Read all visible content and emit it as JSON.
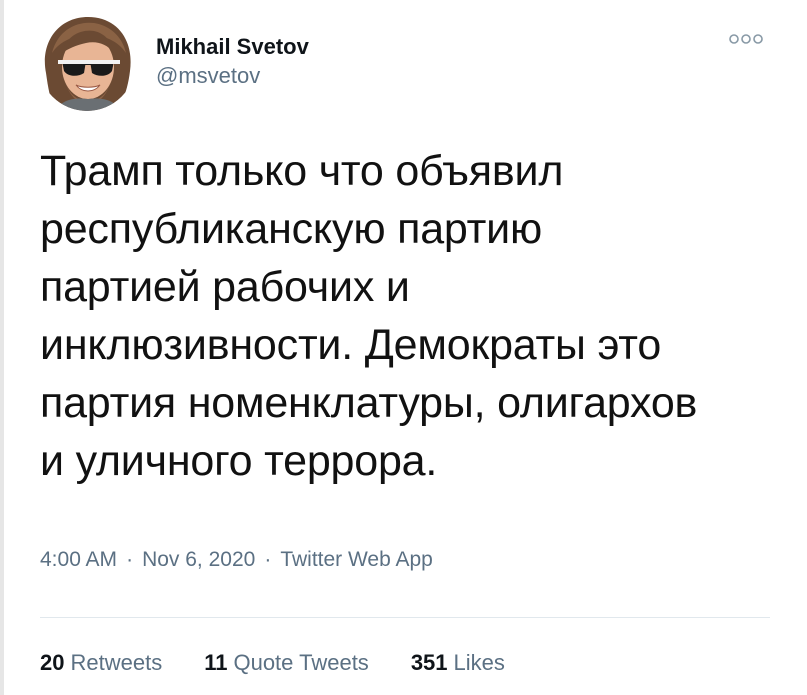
{
  "author": {
    "display_name": "Mikhail Svetov",
    "handle": "@msvetov"
  },
  "more_icon": "more-options-icon",
  "tweet": {
    "text": "Трамп только что объявил\nреспубликанскую партию\nпартией рабочих и\nинклюзивности. Демократы это\nпартия номенклатуры, олигархов\nи уличного террора."
  },
  "meta": {
    "time": "4:00 AM",
    "separator": "·",
    "date": "Nov 6, 2020",
    "source": "Twitter Web App"
  },
  "stats": {
    "retweets": {
      "count": "20",
      "label": "Retweets"
    },
    "quote_tweets": {
      "count": "11",
      "label": "Quote Tweets"
    },
    "likes": {
      "count": "351",
      "label": "Likes"
    }
  },
  "colors": {
    "text_primary": "#0f1419",
    "text_secondary": "#5b7083",
    "divider": "#e1e8ed"
  }
}
